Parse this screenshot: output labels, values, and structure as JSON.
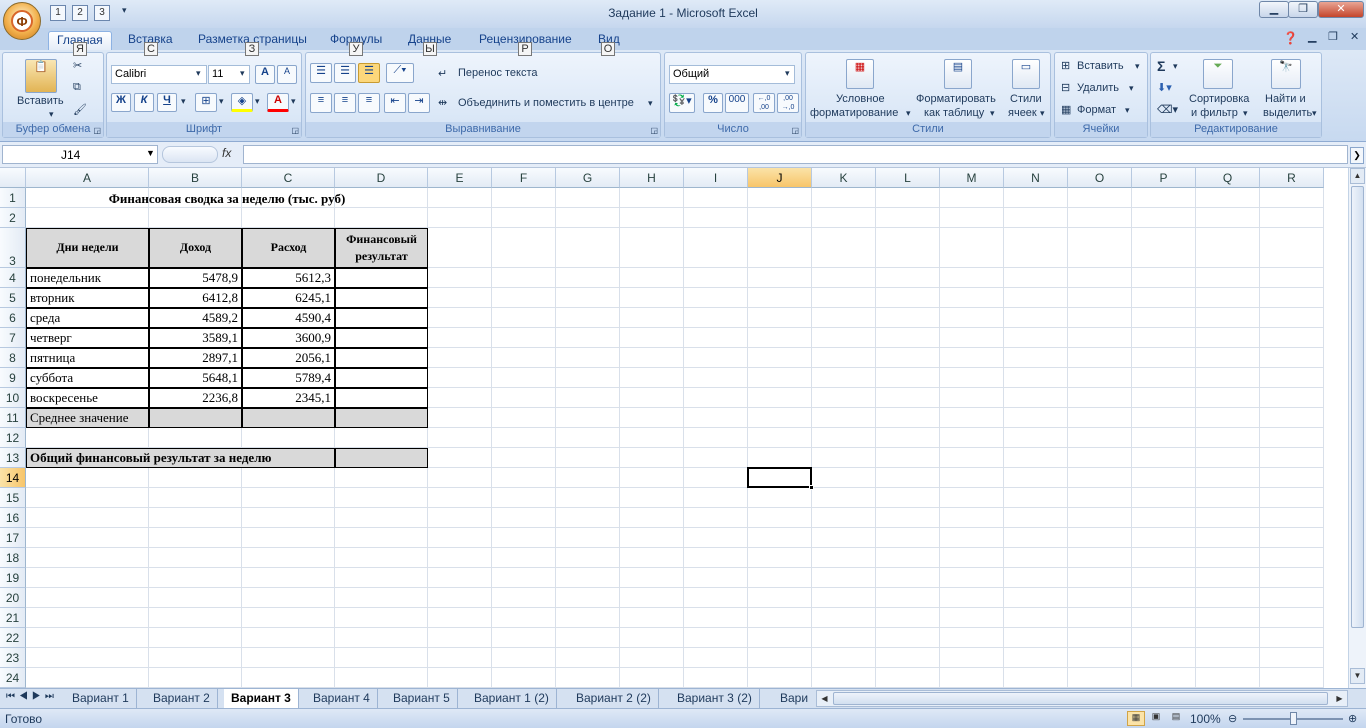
{
  "window": {
    "title": "Задание 1 - Microsoft Excel",
    "office_button_letter": "Ф",
    "qat_keytips": [
      "1",
      "2",
      "3"
    ]
  },
  "ribbon_tabs": [
    {
      "label": "Главная",
      "key": "Я"
    },
    {
      "label": "Вставка",
      "key": "С"
    },
    {
      "label": "Разметка страницы",
      "key": "З"
    },
    {
      "label": "Формулы",
      "key": "У"
    },
    {
      "label": "Данные",
      "key": "Ы"
    },
    {
      "label": "Рецензирование",
      "key": "Р"
    },
    {
      "label": "Вид",
      "key": "О"
    }
  ],
  "ribbon": {
    "clipboard": {
      "label": "Буфер обмена",
      "paste": "Вставить"
    },
    "font": {
      "label": "Шрифт",
      "name": "Calibri",
      "size": "11",
      "bold": "Ж",
      "italic": "К",
      "underline": "Ч",
      "grow": "A",
      "shrink": "A",
      "color": "A"
    },
    "alignment": {
      "label": "Выравнивание",
      "wrap": "Перенос текста",
      "merge": "Объединить и поместить в центре"
    },
    "number": {
      "label": "Число",
      "format": "Общий",
      "percent": "%",
      "thousands": "000",
      "inc": "←,0 ,00",
      "dec": ",00 →,0"
    },
    "styles": {
      "label": "Стили",
      "conditional_1": "Условное",
      "conditional_2": "форматирование",
      "format_table_1": "Форматировать",
      "format_table_2": "как таблицу",
      "cell_styles_1": "Стили",
      "cell_styles_2": "ячеек"
    },
    "cells": {
      "label": "Ячейки",
      "insert": "Вставить",
      "delete": "Удалить",
      "format": "Формат"
    },
    "editing": {
      "label": "Редактирование",
      "sort_1": "Сортировка",
      "sort_2": "и фильтр",
      "find_1": "Найти и",
      "find_2": "выделить",
      "sigma": "Σ"
    }
  },
  "formula_bar": {
    "name_box": "J14",
    "fx": "fx",
    "content": ""
  },
  "columns": [
    "A",
    "B",
    "C",
    "D",
    "E",
    "F",
    "G",
    "H",
    "I",
    "J",
    "K",
    "L",
    "M",
    "N",
    "O",
    "P",
    "Q",
    "R"
  ],
  "rows": [
    "1",
    "2",
    "3",
    "4",
    "5",
    "6",
    "7",
    "8",
    "9",
    "10",
    "11",
    "12",
    "13",
    "14",
    "15",
    "16",
    "17",
    "18",
    "19",
    "20",
    "21",
    "22",
    "23",
    "24"
  ],
  "sheet": {
    "title": "Финансовая сводка за неделю (тыс. руб)",
    "headers": {
      "day": "Дни недели",
      "income": "Доход",
      "expense": "Расход",
      "result_1": "Финансовый",
      "result_2": "результат"
    },
    "data": [
      {
        "day": "понедельник",
        "income": "5478,9",
        "expense": "5612,3"
      },
      {
        "day": "вторник",
        "income": "6412,8",
        "expense": "6245,1"
      },
      {
        "day": "среда",
        "income": "4589,2",
        "expense": "4590,4"
      },
      {
        "day": "четверг",
        "income": "3589,1",
        "expense": "3600,9"
      },
      {
        "day": "пятница",
        "income": "2897,1",
        "expense": "2056,1"
      },
      {
        "day": "суббота",
        "income": "5648,1",
        "expense": "5789,4"
      },
      {
        "day": "воскресенье",
        "income": "2236,8",
        "expense": "2345,1"
      }
    ],
    "average_label": "Среднее значение",
    "total_label": "Общий финансовый результат за неделю"
  },
  "sheet_tabs": [
    "Вариант 1",
    "Вариант 2",
    "Вариант 3",
    "Вариант 4",
    "Вариант 5",
    "Вариант 1 (2)",
    "Вариант 2 (2)",
    "Вариант 3 (2)",
    "Вари"
  ],
  "active_sheet": "Вариант 3",
  "status": {
    "ready": "Готово",
    "zoom": "100%"
  }
}
